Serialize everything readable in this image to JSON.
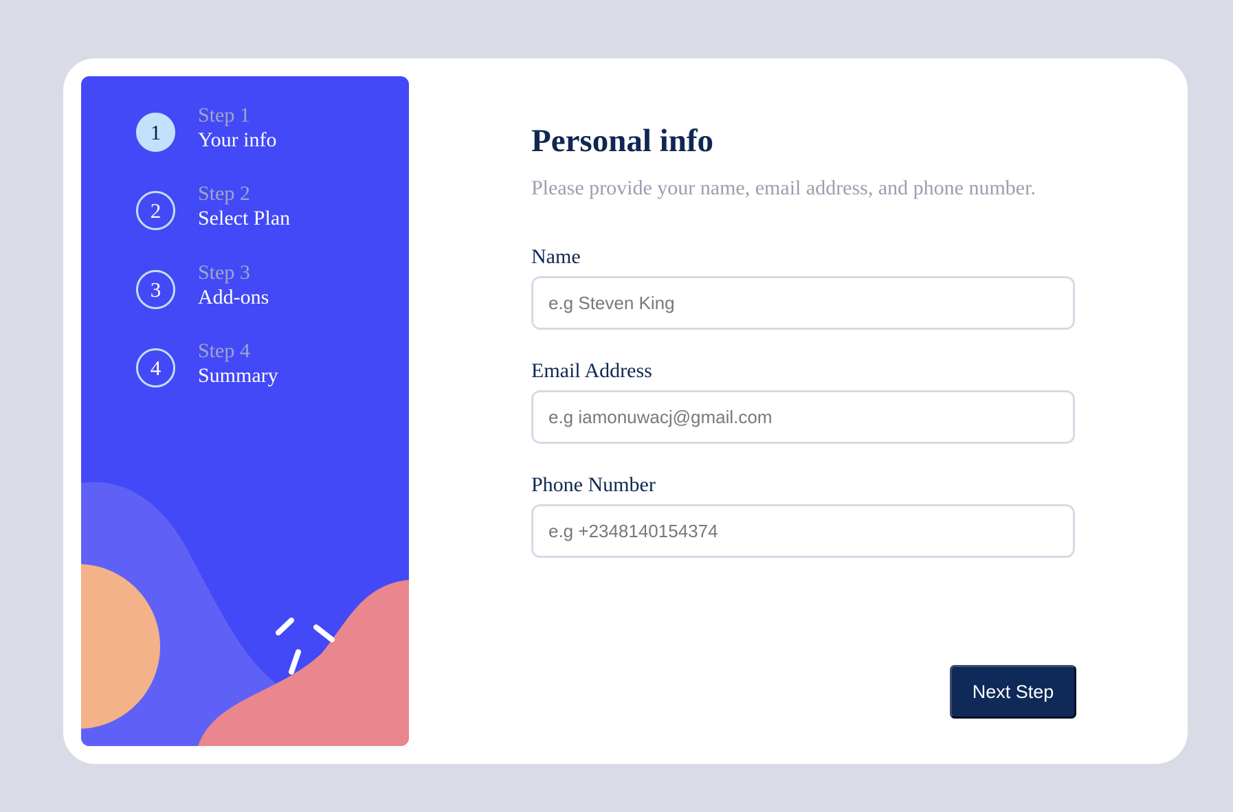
{
  "sidebar": {
    "steps": [
      {
        "number": "1",
        "kicker": "Step 1",
        "title": "Your info",
        "active": true
      },
      {
        "number": "2",
        "kicker": "Step 2",
        "title": "Select Plan",
        "active": false
      },
      {
        "number": "3",
        "kicker": "Step 3",
        "title": "Add-ons",
        "active": false
      },
      {
        "number": "4",
        "kicker": "Step 4",
        "title": "Summary",
        "active": false
      }
    ]
  },
  "form": {
    "title": "Personal info",
    "subtitle": "Please provide your name, email address, and phone number.",
    "fields": {
      "name": {
        "label": "Name",
        "placeholder": "e.g Steven King"
      },
      "email": {
        "label": "Email Address",
        "placeholder": "e.g iamonuwacj@gmail.com"
      },
      "phone": {
        "label": "Phone Number",
        "placeholder": "e.g +2348140154374"
      }
    },
    "next_label": "Next Step"
  },
  "colors": {
    "page_background": "#d9dbe6",
    "sidebar_blue": "#4349f6",
    "active_step": "#c4e1fb",
    "heading_navy": "#0f2752",
    "button_navy": "#0f2958",
    "orange_shape": "#f4b288",
    "pink_shape": "#ea868d",
    "light_purple_shape": "#5f61f6"
  }
}
